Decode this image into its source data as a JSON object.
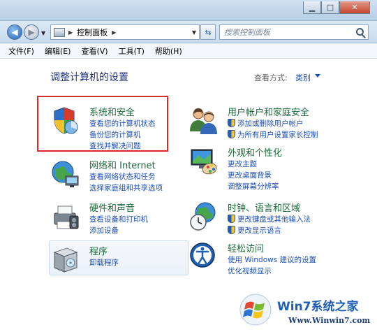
{
  "window": {
    "minimize": "▁",
    "maximize": "□",
    "close": "✕"
  },
  "address": {
    "path": "控制面板",
    "search_placeholder": "搜索控制面板"
  },
  "menu": [
    "文件(F)",
    "编辑(E)",
    "查看(V)",
    "工具(T)",
    "帮助(H)"
  ],
  "main": {
    "heading": "调整计算机的设置",
    "view_by_label": "查看方式:",
    "view_by_value": "类别"
  },
  "categories": {
    "system_security": {
      "title": "系统和安全",
      "links": [
        "查看您的计算机状态",
        "备份您的计算机",
        "查找并解决问题"
      ]
    },
    "network": {
      "title": "网络和 Internet",
      "links": [
        "查看网络状态和任务",
        "选择家庭组和共享选项"
      ]
    },
    "hardware": {
      "title": "硬件和声音",
      "links": [
        "查看设备和打印机",
        "添加设备"
      ]
    },
    "programs": {
      "title": "程序",
      "links": [
        "卸载程序"
      ]
    },
    "user_accounts": {
      "title": "用户帐户和家庭安全",
      "links": [
        "添加或删除用户帐户",
        "为所有用户设置家长控制"
      ]
    },
    "appearance": {
      "title": "外观和个性化",
      "links": [
        "更改主题",
        "更改桌面背景",
        "调整屏幕分辨率"
      ]
    },
    "clock": {
      "title": "时钟、语言和区域",
      "links": [
        "更改键盘或其他输入法",
        "更改显示语言"
      ]
    },
    "ease": {
      "title": "轻松访问",
      "links": [
        "使用 Windows 建议的设置",
        "优化视频显示"
      ]
    }
  },
  "watermark": {
    "title": "Win7系统之家",
    "url": "Www.Winwin7.com"
  },
  "icons": {
    "system_security": "shield-chart-icon",
    "network": "globe-network-icon",
    "hardware": "printer-icon",
    "programs": "software-box-icon",
    "user_accounts": "users-icon",
    "appearance": "monitor-palette-icon",
    "clock": "globe-clock-icon",
    "ease": "accessibility-icon"
  },
  "colors": {
    "category_title": "#1a6a3a",
    "link": "#1e50b4",
    "heading": "#1e3287",
    "highlight_box": "#d82a2a"
  }
}
